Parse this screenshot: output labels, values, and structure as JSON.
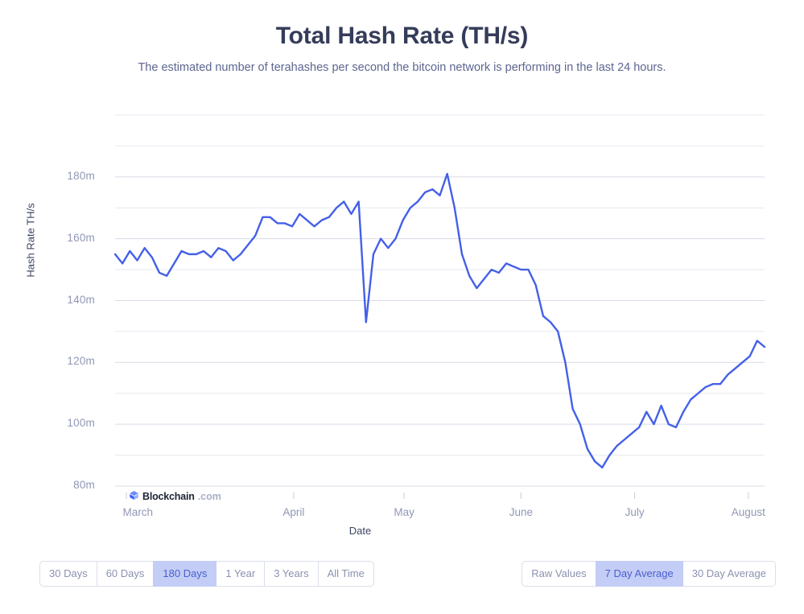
{
  "header": {
    "title": "Total Hash Rate (TH/s)",
    "subtitle": "The estimated number of terahashes per second the bitcoin network is performing in the last 24 hours."
  },
  "watermark": {
    "name": "Blockchain",
    "tld": ".com",
    "logo_icon": "blockchain-cube-icon",
    "color": "#4460e8"
  },
  "controls": {
    "range_buttons": [
      {
        "label": "30 Days",
        "active": false
      },
      {
        "label": "60 Days",
        "active": false
      },
      {
        "label": "180 Days",
        "active": true
      },
      {
        "label": "1 Year",
        "active": false
      },
      {
        "label": "3 Years",
        "active": false
      },
      {
        "label": "All Time",
        "active": false
      }
    ],
    "average_buttons": [
      {
        "label": "Raw Values",
        "active": false
      },
      {
        "label": "7 Day Average",
        "active": true
      },
      {
        "label": "30 Day Average",
        "active": false
      }
    ],
    "active_color": "#c3cdf5",
    "active_text_color": "#4a5fd0"
  },
  "chart_data": {
    "type": "line",
    "title": "Total Hash Rate (TH/s)",
    "subtitle": "The estimated number of terahashes per second the bitcoin network is performing in the last 24 hours.",
    "xlabel": "Date",
    "ylabel": "Hash Rate TH/s",
    "line_color": "#4460e8",
    "grid": true,
    "legend": "none",
    "ylim": [
      76,
      200
    ],
    "yticks": [
      80,
      100,
      120,
      140,
      160,
      180
    ],
    "ytick_labels": [
      "80m",
      "100m",
      "120m",
      "140m",
      "160m",
      "180m"
    ],
    "y_minor_gridlines": [
      90,
      110,
      130,
      150,
      170,
      190,
      200
    ],
    "xticks": [
      "March",
      "April",
      "May",
      "June",
      "July",
      "August"
    ],
    "xtick_positions_pct": [
      3.5,
      27.5,
      44.5,
      62.5,
      80.0,
      97.5
    ],
    "units": "millions of TH/s",
    "series": [
      {
        "name": "Hash Rate (7 Day Average)",
        "x": [
          "Mar 1",
          "Mar 3",
          "Mar 5",
          "Mar 7",
          "Mar 9",
          "Mar 11",
          "Mar 13",
          "Mar 15",
          "Mar 17",
          "Mar 19",
          "Mar 21",
          "Mar 23",
          "Mar 25",
          "Mar 27",
          "Mar 29",
          "Mar 31",
          "Apr 2",
          "Apr 4",
          "Apr 6",
          "Apr 8",
          "Apr 10",
          "Apr 12",
          "Apr 14",
          "Apr 16",
          "Apr 18",
          "Apr 20",
          "Apr 22",
          "Apr 24",
          "Apr 26",
          "Apr 28",
          "Apr 30",
          "May 2",
          "May 4",
          "May 6",
          "May 8",
          "May 10",
          "May 12",
          "May 14",
          "May 16",
          "May 18",
          "May 20",
          "May 22",
          "May 24",
          "May 26",
          "May 28",
          "May 30",
          "Jun 1",
          "Jun 3",
          "Jun 5",
          "Jun 7",
          "Jun 9",
          "Jun 11",
          "Jun 13",
          "Jun 15",
          "Jun 17",
          "Jun 19",
          "Jun 21",
          "Jun 23",
          "Jun 25",
          "Jun 27",
          "Jun 29",
          "Jul 1",
          "Jul 3",
          "Jul 5",
          "Jul 7",
          "Jul 9",
          "Jul 11",
          "Jul 13",
          "Jul 15",
          "Jul 17",
          "Jul 19",
          "Jul 21",
          "Jul 23",
          "Jul 25",
          "Jul 27",
          "Jul 29",
          "Jul 31",
          "Aug 2",
          "Aug 4",
          "Aug 6",
          "Aug 8",
          "Aug 10",
          "Aug 12",
          "Aug 14",
          "Aug 16",
          "Aug 18",
          "Aug 20",
          "Aug 22",
          "Aug 24",
          "Aug 26",
          "Aug 28"
        ],
        "values": [
          155,
          152,
          156,
          153,
          157,
          154,
          149,
          148,
          152,
          156,
          155,
          155,
          156,
          154,
          157,
          156,
          153,
          155,
          158,
          161,
          167,
          167,
          165,
          165,
          164,
          168,
          166,
          164,
          166,
          167,
          170,
          172,
          168,
          172,
          133,
          155,
          160,
          157,
          160,
          166,
          170,
          172,
          175,
          176,
          174,
          181,
          170,
          155,
          148,
          144,
          147,
          150,
          149,
          152,
          151,
          150,
          150,
          145,
          135,
          133,
          130,
          120,
          105,
          100,
          92,
          88,
          86,
          90,
          93,
          95,
          97,
          99,
          104,
          100,
          106,
          100,
          99,
          104,
          108,
          110,
          112,
          113,
          113,
          116,
          118,
          120,
          122,
          127,
          125
        ]
      }
    ]
  }
}
